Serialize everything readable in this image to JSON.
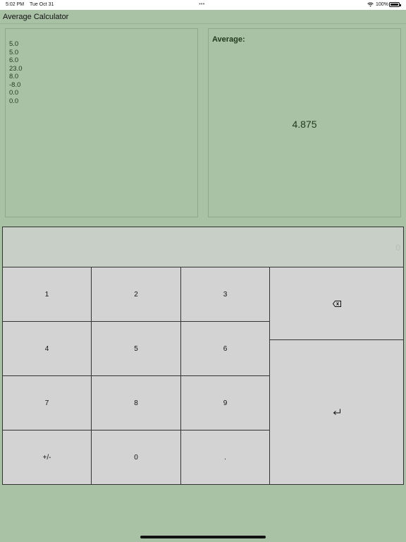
{
  "status_bar": {
    "time": "5:02 PM",
    "date": "Tue Oct 31",
    "multitasking_dots": "•••",
    "battery_percent": "100%",
    "icons": [
      "wifi-icon",
      "battery-icon"
    ]
  },
  "app": {
    "title": "Average Calculator"
  },
  "numbers_list": [
    "5.0",
    "5.0",
    "6.0",
    "23.0",
    "8.0",
    "-8.0",
    "0.0",
    "0.0"
  ],
  "average": {
    "label": "Average:",
    "value": "4.875"
  },
  "display": {
    "value": "0"
  },
  "keys": {
    "k1": "1",
    "k2": "2",
    "k3": "3",
    "k4": "4",
    "k5": "5",
    "k6": "6",
    "k7": "7",
    "k8": "8",
    "k9": "9",
    "sign": "+/-",
    "k0": "0",
    "dot": ".",
    "backspace_icon": "delete-backward-icon",
    "enter_icon": "return-icon"
  },
  "colors": {
    "background": "#a9c2a6",
    "key_background": "#d3d3d3",
    "display_background": "#c7cfc6",
    "text_accent": "#1e3a1e"
  }
}
